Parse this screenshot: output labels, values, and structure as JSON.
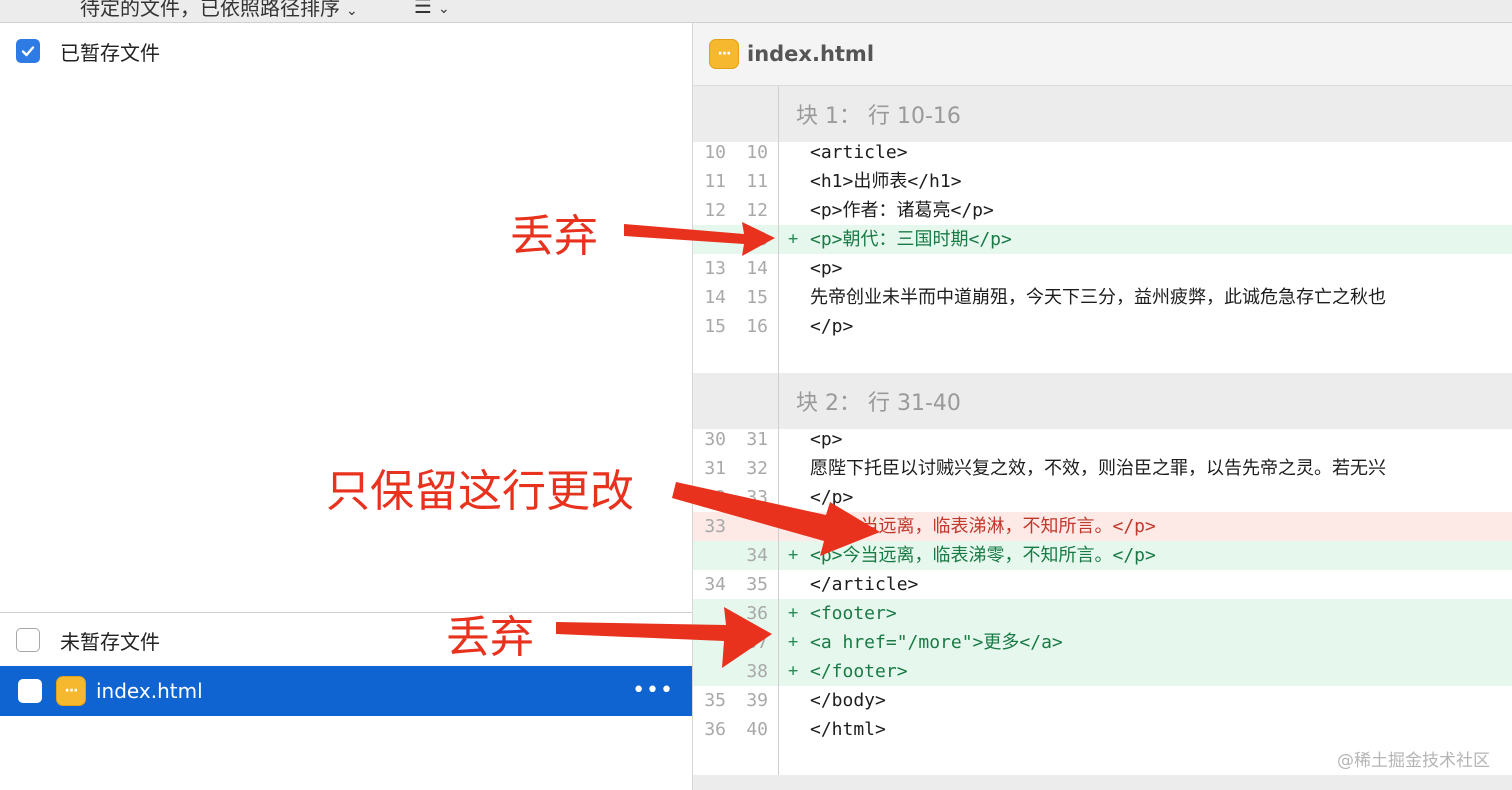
{
  "toolbar": {
    "sort_label": "待定的文件，已依照路径排序",
    "sort_chevron": "⌄",
    "list_icon": "list-icon",
    "list_glyph": "☰",
    "list_chevron": "⌄"
  },
  "sidebar": {
    "staged": {
      "label": "已暂存文件",
      "checked": true
    },
    "unstaged": {
      "label": "未暂存文件",
      "checked": false
    },
    "files": [
      {
        "name": "index.html",
        "icon": "html-file-icon",
        "icon_glyph": "···",
        "selected": true,
        "more_glyph": "•••"
      }
    ]
  },
  "diff": {
    "file_name": "index.html",
    "file_icon_glyph": "···",
    "hunks": [
      {
        "header": "块 1： 行 10-16",
        "lines": [
          {
            "old": "10",
            "new": "10",
            "type": "ctx",
            "mark": "",
            "text": "    <article>"
          },
          {
            "old": "11",
            "new": "11",
            "type": "ctx",
            "mark": "",
            "text": "      <h1>出师表</h1>"
          },
          {
            "old": "12",
            "new": "12",
            "type": "ctx",
            "mark": "",
            "text": "      <p>作者：诸葛亮</p>"
          },
          {
            "old": "",
            "new": "13",
            "type": "add",
            "mark": "+",
            "text": "      <p>朝代：三国时期</p>"
          },
          {
            "old": "13",
            "new": "14",
            "type": "ctx",
            "mark": "",
            "text": "      <p>"
          },
          {
            "old": "14",
            "new": "15",
            "type": "ctx",
            "mark": "",
            "text": "        先帝创业未半而中道崩殂，今天下三分，益州疲弊，此诚危急存亡之秋也"
          },
          {
            "old": "15",
            "new": "16",
            "type": "ctx",
            "mark": "",
            "text": "      </p>"
          }
        ]
      },
      {
        "header": "块 2： 行 31-40",
        "lines": [
          {
            "old": "30",
            "new": "31",
            "type": "ctx",
            "mark": "",
            "text": "      <p>"
          },
          {
            "old": "31",
            "new": "32",
            "type": "ctx",
            "mark": "",
            "text": "        愿陛下托臣以讨贼兴复之效，不效，则治臣之罪，以告先帝之灵。若无兴"
          },
          {
            "old": "32",
            "new": "33",
            "type": "ctx",
            "mark": "",
            "text": "      </p>"
          },
          {
            "old": "33",
            "new": "",
            "type": "del",
            "mark": "",
            "text": "      <p>今当远离，临表涕淋，不知所言。</p>"
          },
          {
            "old": "",
            "new": "34",
            "type": "add",
            "mark": "+",
            "text": "      <p>今当远离，临表涕零，不知所言。</p>"
          },
          {
            "old": "34",
            "new": "35",
            "type": "ctx",
            "mark": "",
            "text": "    </article>"
          },
          {
            "old": "",
            "new": "36",
            "type": "add",
            "mark": "+",
            "text": "    <footer>"
          },
          {
            "old": "",
            "new": "37",
            "type": "add",
            "mark": "+",
            "text": "      <a href=\"/more\">更多</a>"
          },
          {
            "old": "",
            "new": "38",
            "type": "add",
            "mark": "+",
            "text": "    </footer>"
          },
          {
            "old": "35",
            "new": "39",
            "type": "ctx",
            "mark": "",
            "text": "  </body>"
          },
          {
            "old": "36",
            "new": "40",
            "type": "ctx",
            "mark": "",
            "text": "</html>"
          }
        ]
      }
    ]
  },
  "annotations": {
    "discard_1": "丢弃",
    "keep_only": "只保留这行更改",
    "discard_2": "丢弃"
  },
  "watermark": "@稀土掘金技术社区",
  "colors": {
    "accent": "#0f64d2",
    "checkbox": "#2f7be6",
    "add_bg": "#e6f8ee",
    "del_bg": "#fde9e6",
    "annotation": "#e8321e",
    "file_icon": "#f5b82e"
  }
}
